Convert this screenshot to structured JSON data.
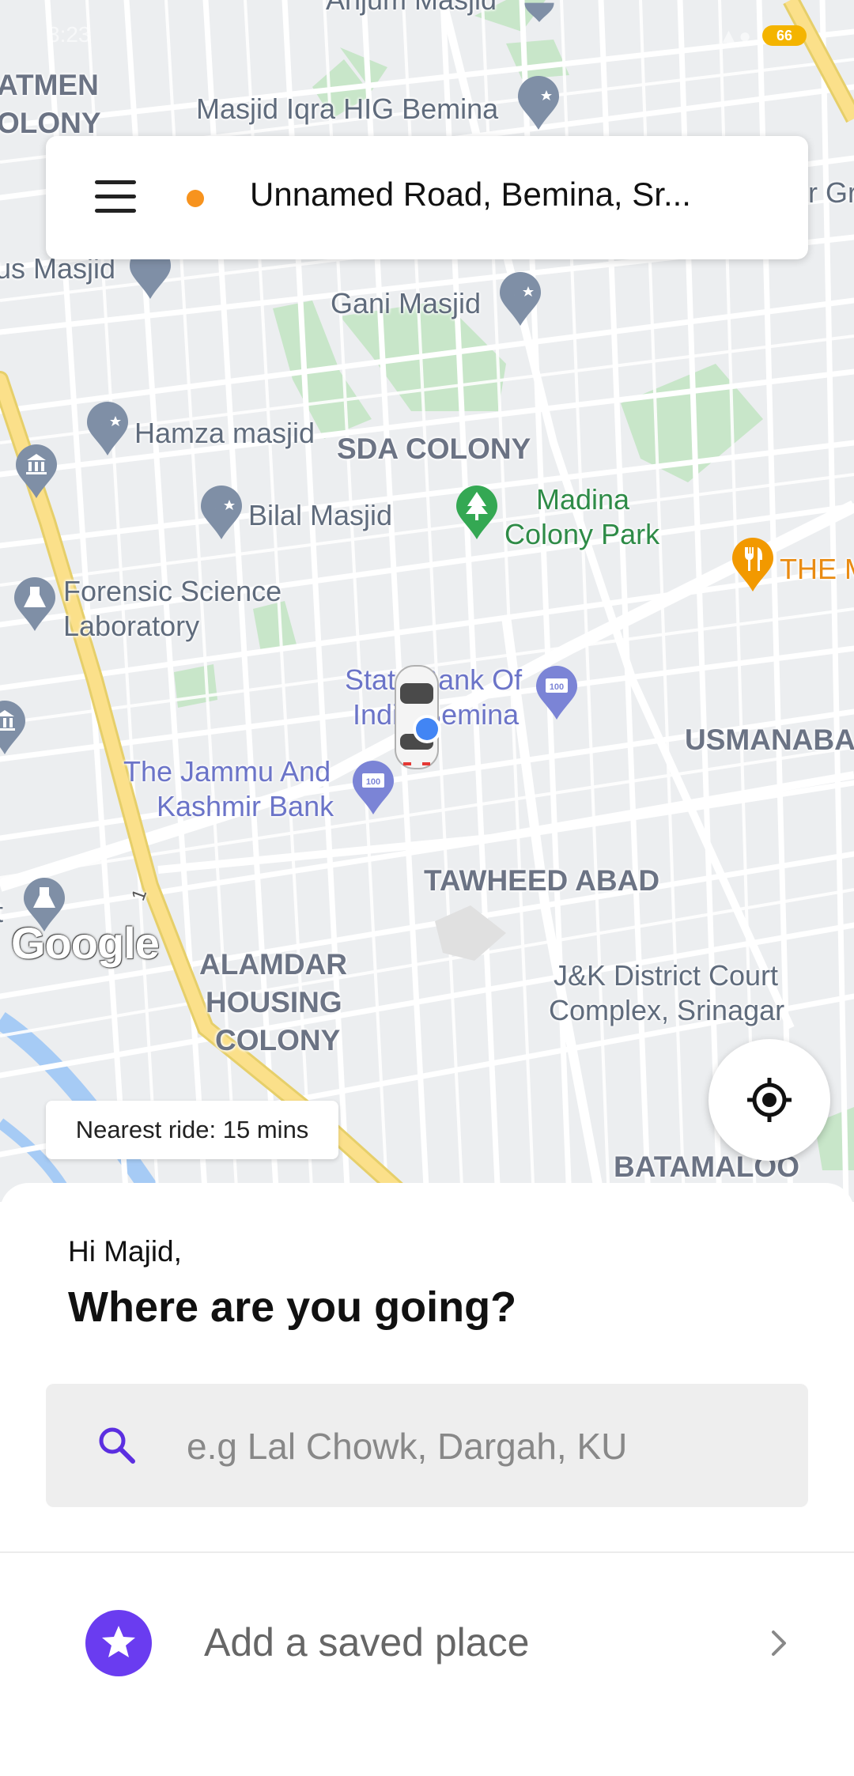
{
  "status_bar": {
    "time": "3:23",
    "battery": "66"
  },
  "address_bar": {
    "address": "Unnamed Road,  Bemina,  Sr..."
  },
  "map": {
    "labels": {
      "anjum_masjid": "Anjum Masjid",
      "atmen": "ATMEN",
      "olony": "OLONY",
      "masjid_iqra": "Masjid Iqra HIG Bemina",
      "r_gri": "r Gri",
      "us_masjid": "us Masjid",
      "gani_masjid": "Gani Masjid",
      "hamza_masjid": "Hamza masjid",
      "sda_colony": "SDA COLONY",
      "bilal_masjid": "Bilal Masjid",
      "madina_park_1": "Madina",
      "madina_park_2": "Colony Park",
      "the_m": "THE M",
      "forensic_1": "Forensic Science",
      "forensic_2": "Laboratory",
      "state_bank_1": "State Bank Of",
      "state_bank_2": "India Bemina",
      "usmanabad": "USMANABAD",
      "jk_bank_1": "The Jammu And",
      "jk_bank_2": "Kashmir Bank",
      "tawheed_abad": "TAWHEED ABAD",
      "t": "t",
      "road_number": "1",
      "alamdar_1": "ALAMDAR",
      "alamdar_2": "HOUSING",
      "alamdar_3": "COLONY",
      "court_1": "J&K District Court",
      "court_2": "Complex, Srinagar",
      "batamaloo": "BATAMALOO"
    },
    "google_logo": "Google",
    "nearest_ride": "Nearest ride: 15 mins"
  },
  "sheet": {
    "greeting": "Hi Majid,",
    "question": "Where are you going?",
    "search_placeholder": "e.g Lal Chowk, Dargah, KU",
    "saved_place": "Add a saved place"
  },
  "colors": {
    "accent": "#6a3cf0",
    "origin_dot": "#f7931e",
    "map_bg": "#eceef0",
    "road": "#ffffff",
    "highway": "#fbe08a",
    "park": "#c8e6c9"
  },
  "icons": [
    "menu-icon",
    "origin-dot-icon",
    "mosque-pin-icon",
    "museum-pin-icon",
    "park-pin-icon",
    "restaurant-pin-icon",
    "bank-pin-icon",
    "car-marker-icon",
    "my-location-icon",
    "crosshair-icon",
    "search-icon",
    "star-icon",
    "chevron-right-icon"
  ]
}
